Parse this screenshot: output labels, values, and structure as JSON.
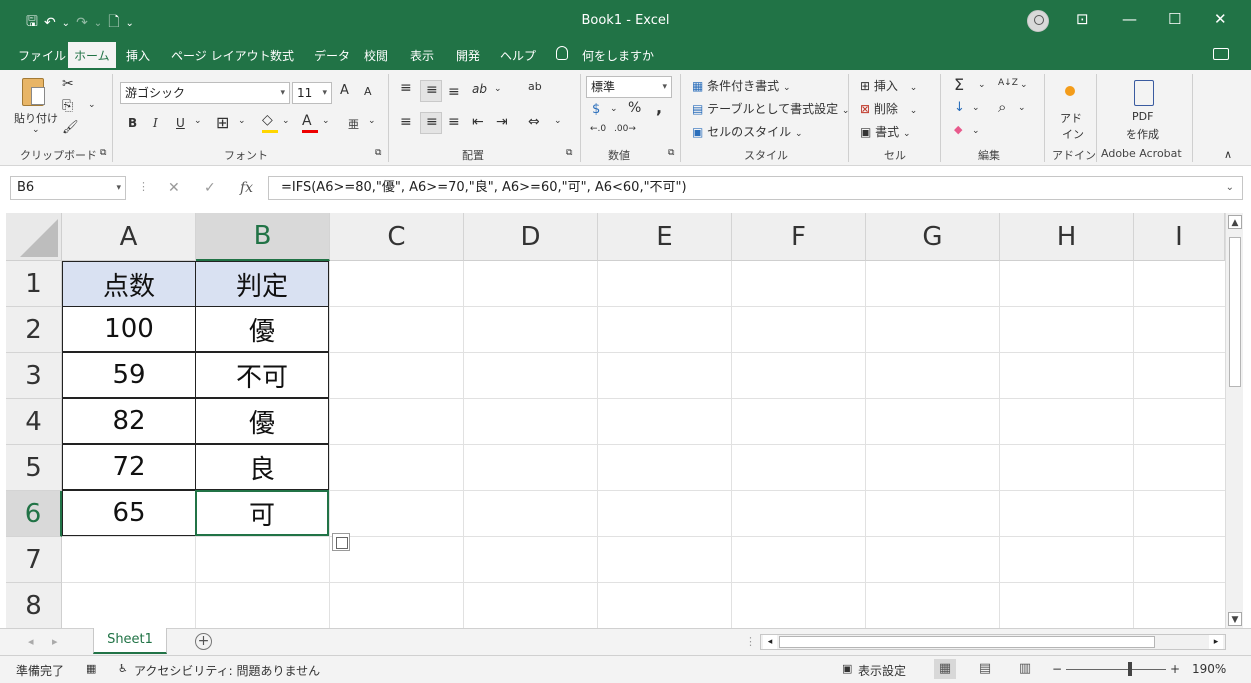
{
  "window": {
    "title_doc": "Book1",
    "title_sep": " - ",
    "title_app": "Excel",
    "qat": {
      "save": "🖫",
      "undo": "↶",
      "undo_drop": "⌄",
      "redo": "↷",
      "redo_drop": "⌄",
      "new": "🗋",
      "customize": "⌄"
    },
    "controls": {
      "ribbon_display": "⊡",
      "minimize": "—",
      "maximize": "☐",
      "close": "✕"
    }
  },
  "tabs": [
    {
      "label": "ファイル"
    },
    {
      "label": "ホーム",
      "active": true
    },
    {
      "label": "挿入"
    },
    {
      "label": "ページ レイアウト"
    },
    {
      "label": "数式"
    },
    {
      "label": "データ"
    },
    {
      "label": "校閲"
    },
    {
      "label": "表示"
    },
    {
      "label": "開発"
    },
    {
      "label": "ヘルプ"
    }
  ],
  "tell_me": "何をしますか",
  "ribbon": {
    "clipboard": {
      "label": "クリップボード",
      "paste": "貼り付け",
      "paste_drop": "⌄",
      "cut": "✂",
      "copy": "⎘",
      "copy_drop": "⌄",
      "format_painter": "🖌",
      "launcher": "⧉"
    },
    "font": {
      "label": "フォント",
      "family": "游ゴシック",
      "size": "11",
      "grow": "A",
      "shrink": "A",
      "bold": "B",
      "italic": "I",
      "underline": "U",
      "underline_drop": "⌄",
      "borders": "⊞",
      "borders_drop": "⌄",
      "fill": "◇",
      "fill_drop": "⌄",
      "font_color": "A",
      "font_color_drop": "⌄",
      "phonetic": "亜",
      "phonetic_drop": "⌄",
      "launcher": "⧉"
    },
    "alignment": {
      "label": "配置",
      "top": "≡",
      "middle": "≡",
      "bottom": "≡",
      "orient": "ab",
      "orient_drop": "⌄",
      "wrap": "ab",
      "left": "≡",
      "center": "≡",
      "right": "≡",
      "dec_indent": "⇤",
      "inc_indent": "⇥",
      "merge": "⇔",
      "merge_drop": "⌄",
      "launcher": "⧉"
    },
    "number": {
      "label": "数値",
      "format": "標準",
      "currency": "$",
      "currency_drop": "⌄",
      "percent": "%",
      "comma": ",",
      "inc_decimal": "←.0",
      "dec_decimal": ".00→",
      "launcher": "⧉"
    },
    "styles": {
      "label": "スタイル",
      "conditional": "条件付き書式",
      "table": "テーブルとして書式設定",
      "cell_styles": "セルのスタイル",
      "drop": "⌄"
    },
    "cells": {
      "label": "セル",
      "insert": "挿入",
      "delete": "削除",
      "format": "書式",
      "drop": "⌄"
    },
    "editing": {
      "label": "編集",
      "sum": "Σ",
      "sort": "A↓Z",
      "fill": "↓",
      "find": "⌕",
      "clear": "◆",
      "drop": "⌄"
    },
    "addins": {
      "label": "アドイン",
      "button": "アド",
      "button2": "イン"
    },
    "acrobat": {
      "label": "Adobe Acrobat",
      "pdf": "PDF",
      "create": "を作成"
    },
    "collapse": "∧"
  },
  "formula_bar": {
    "name_box": "B6",
    "cancel": "✕",
    "enter": "✓",
    "fx": "fx",
    "formula": "=IFS(A6>=80,\"優\", A6>=70,\"良\", A6>=60,\"可\", A6<60,\"不可\")",
    "expand": "⌄"
  },
  "grid": {
    "columns": [
      "A",
      "B",
      "C",
      "D",
      "E",
      "F",
      "G",
      "H",
      "I"
    ],
    "rows": [
      "1",
      "2",
      "3",
      "4",
      "5",
      "6",
      "7",
      "8"
    ],
    "table": [
      [
        "点数",
        "判定"
      ],
      [
        "100",
        "優"
      ],
      [
        "59",
        "不可"
      ],
      [
        "82",
        "優"
      ],
      [
        "72",
        "良"
      ],
      [
        "65",
        "可"
      ]
    ],
    "header_fill": "#d9e1f2",
    "selection_color": "#217346"
  },
  "sheets": {
    "nav_prev": "◂",
    "nav_next": "▸",
    "active": "Sheet1",
    "add": "+",
    "dots": "⋮",
    "scroll_left": "◂",
    "scroll_right": "▸"
  },
  "status": {
    "ready": "準備完了",
    "macro_icon": "▦",
    "accessibility": "アクセシビリティ: 問題ありません",
    "accessibility_icon": "♿",
    "display_settings": "表示設定",
    "view_normal": "▦",
    "view_layout": "▤",
    "view_break": "▥",
    "zoom_out": "−",
    "zoom_in": "+",
    "zoom": "190%"
  },
  "colors": {
    "brand": "#217346",
    "ribbon_bg": "#f3f3f3"
  }
}
